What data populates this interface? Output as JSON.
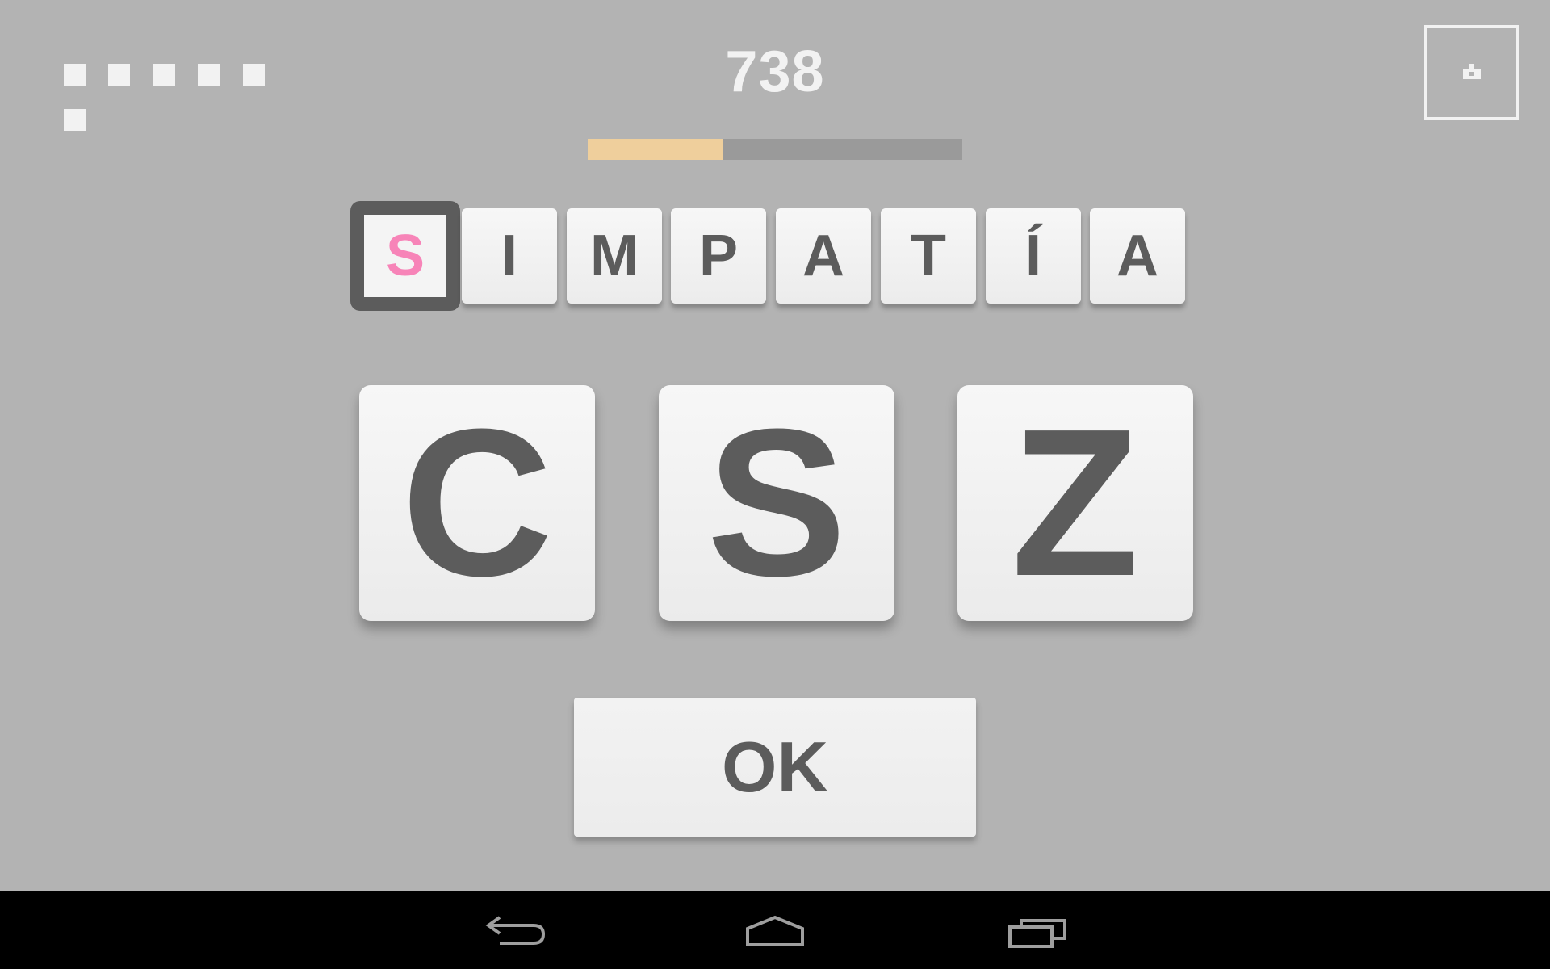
{
  "hud": {
    "score": "738",
    "lives_count": 6,
    "progress": 0.36,
    "corner_button_icon": "exit-icon"
  },
  "word": {
    "letters": [
      "S",
      "I",
      "M",
      "P",
      "A",
      "T",
      "Í",
      "A"
    ],
    "selected_index": 0
  },
  "choices": [
    "C",
    "S",
    "Z"
  ],
  "ok_label": "OK",
  "colors": {
    "background": "#b3b3b3",
    "tile_text": "#5c5c5c",
    "selected_letter": "#f784b8",
    "progress_fill": "#efcf9c",
    "progress_track": "#9a9a9a"
  },
  "navbar": {
    "back_icon": "back-arrow-icon",
    "home_icon": "home-icon",
    "recents_icon": "recent-apps-icon"
  }
}
